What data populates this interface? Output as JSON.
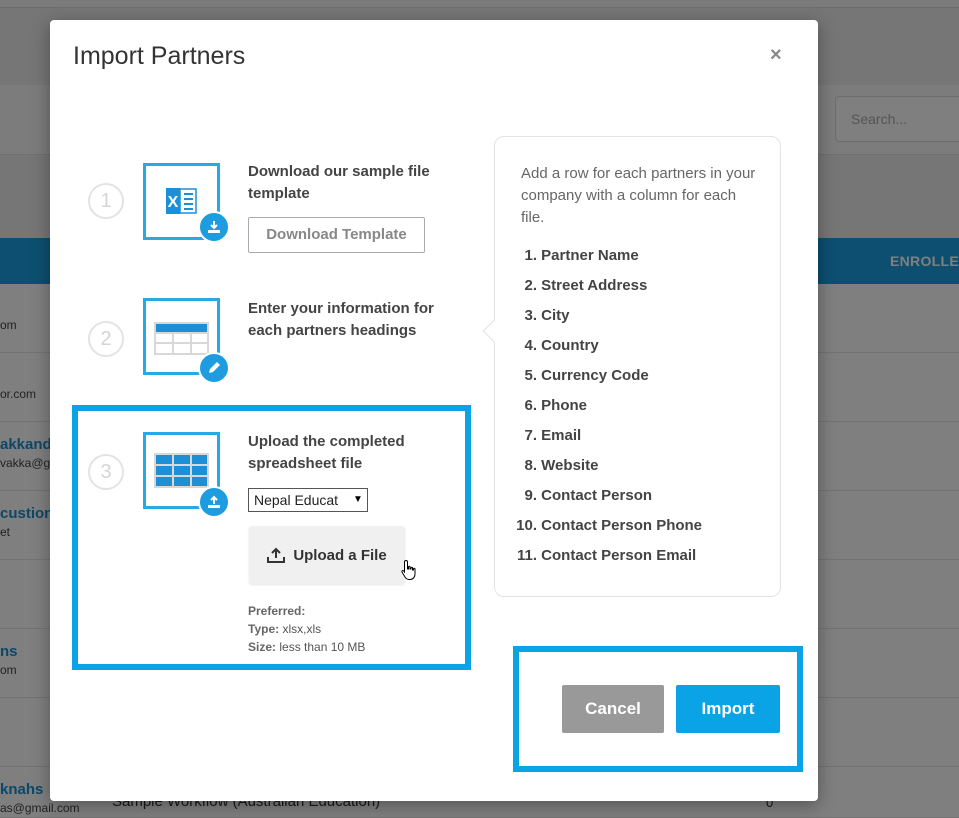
{
  "background": {
    "search_placeholder": "Search...",
    "table_header_label": "ENROLLE",
    "rows": [
      {
        "line1": "",
        "line2": "om"
      },
      {
        "line1": "",
        "line2": "or.com"
      },
      {
        "line1": "akkanda",
        "line2": "vakka@gr"
      },
      {
        "line1": "custion",
        "line2": "et"
      },
      {
        "line1": "",
        "line2": ""
      },
      {
        "line1": "ns",
        "line2": "om"
      },
      {
        "line1": "",
        "line2": ""
      },
      {
        "line1": "knahs",
        "line2": "as@gmail.com"
      }
    ],
    "workflow_text": "Sample Workflow (Australian Education)",
    "count_text": "0"
  },
  "modal": {
    "title": "Import Partners",
    "close_symbol": "×",
    "steps": [
      {
        "number": "1",
        "text": "Download our sample file template",
        "icon": "excel-download-icon"
      },
      {
        "number": "2",
        "text": "Enter your information for each partners headings",
        "icon": "spreadsheet-edit-icon"
      },
      {
        "number": "3",
        "text": "Upload the completed spreadsheet file",
        "icon": "spreadsheet-upload-icon"
      }
    ],
    "download_template_label": "Download Template",
    "select": {
      "selected": "Nepal Educat",
      "arrow": "▼"
    },
    "upload_button_label": "Upload a File",
    "preferred": {
      "heading": "Preferred:",
      "type_label": "Type:",
      "type_value": "xlsx,xls",
      "size_label": "Size:",
      "size_value": "less than 10 MB"
    },
    "info": {
      "intro": "Add a row for each partners in your company with a column for each file.",
      "fields": [
        {
          "num": "1.",
          "label": "Partner Name"
        },
        {
          "num": "2.",
          "label": "Street Address"
        },
        {
          "num": "3.",
          "label": "City"
        },
        {
          "num": "4.",
          "label": "Country"
        },
        {
          "num": "5.",
          "label": "Currency Code"
        },
        {
          "num": "6.",
          "label": "Phone"
        },
        {
          "num": "7.",
          "label": "Email"
        },
        {
          "num": "8.",
          "label": "Website"
        },
        {
          "num": "9.",
          "label": "Contact Person"
        },
        {
          "num": "10.",
          "label": "Contact Person Phone"
        },
        {
          "num": "11.",
          "label": "Contact Person Email"
        }
      ]
    },
    "cancel_label": "Cancel",
    "import_label": "Import"
  },
  "colors": {
    "accent": "#0aa3e6",
    "icon_border": "#29a9e3",
    "cancel_bg": "#999999",
    "table_header_bg": "#1a9fe2"
  }
}
